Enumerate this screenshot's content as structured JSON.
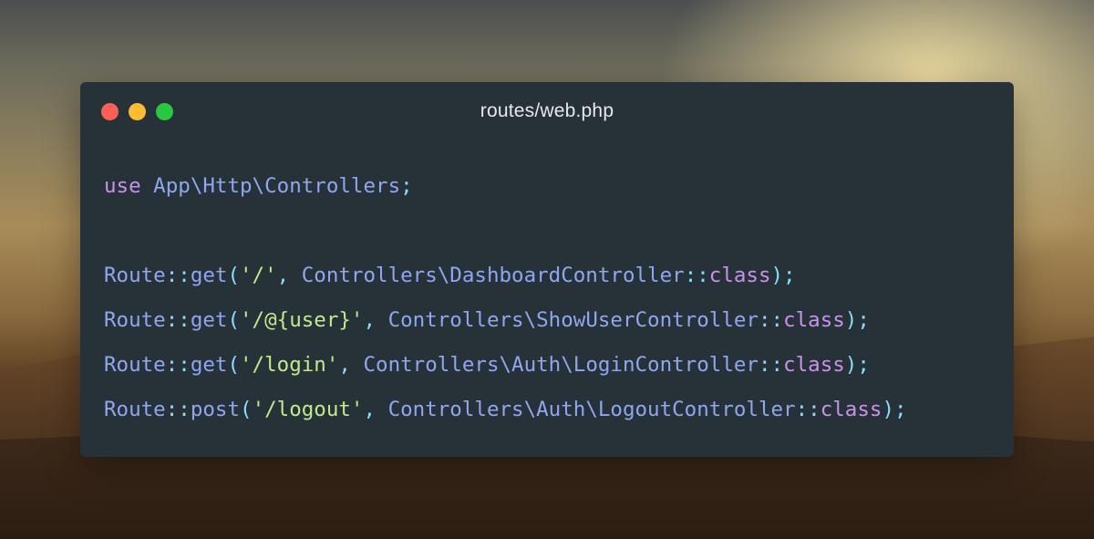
{
  "window": {
    "title": "routes/web.php",
    "controls": [
      {
        "name": "close",
        "color": "#ff5f57"
      },
      {
        "name": "minimize",
        "color": "#febc2e"
      },
      {
        "name": "zoom",
        "color": "#28c840"
      }
    ]
  },
  "colors": {
    "editor_background": "#263238",
    "keyword": "#c792ea",
    "identifier": "#8fa6f0",
    "operator": "#89ddff",
    "string": "#c3e88d"
  },
  "code": {
    "lines": [
      [
        {
          "t": "use",
          "k": "kw"
        },
        {
          "t": " App\\Http\\Controllers",
          "k": "id"
        },
        {
          "t": ";",
          "k": "punc"
        }
      ],
      [],
      [
        {
          "t": "Route",
          "k": "id"
        },
        {
          "t": "::",
          "k": "op"
        },
        {
          "t": "get",
          "k": "id"
        },
        {
          "t": "(",
          "k": "punc"
        },
        {
          "t": "'/'",
          "k": "str"
        },
        {
          "t": ", ",
          "k": "punc"
        },
        {
          "t": "Controllers\\DashboardController",
          "k": "id"
        },
        {
          "t": "::",
          "k": "op"
        },
        {
          "t": "class",
          "k": "kw"
        },
        {
          "t": ");",
          "k": "punc"
        }
      ],
      [
        {
          "t": "Route",
          "k": "id"
        },
        {
          "t": "::",
          "k": "op"
        },
        {
          "t": "get",
          "k": "id"
        },
        {
          "t": "(",
          "k": "punc"
        },
        {
          "t": "'/@{user}'",
          "k": "str"
        },
        {
          "t": ", ",
          "k": "punc"
        },
        {
          "t": "Controllers\\ShowUserController",
          "k": "id"
        },
        {
          "t": "::",
          "k": "op"
        },
        {
          "t": "class",
          "k": "kw"
        },
        {
          "t": ");",
          "k": "punc"
        }
      ],
      [
        {
          "t": "Route",
          "k": "id"
        },
        {
          "t": "::",
          "k": "op"
        },
        {
          "t": "get",
          "k": "id"
        },
        {
          "t": "(",
          "k": "punc"
        },
        {
          "t": "'/login'",
          "k": "str"
        },
        {
          "t": ", ",
          "k": "punc"
        },
        {
          "t": "Controllers\\Auth\\LoginController",
          "k": "id"
        },
        {
          "t": "::",
          "k": "op"
        },
        {
          "t": "class",
          "k": "kw"
        },
        {
          "t": ");",
          "k": "punc"
        }
      ],
      [
        {
          "t": "Route",
          "k": "id"
        },
        {
          "t": "::",
          "k": "op"
        },
        {
          "t": "post",
          "k": "id"
        },
        {
          "t": "(",
          "k": "punc"
        },
        {
          "t": "'/logout'",
          "k": "str"
        },
        {
          "t": ", ",
          "k": "punc"
        },
        {
          "t": "Controllers\\Auth\\LogoutController",
          "k": "id"
        },
        {
          "t": "::",
          "k": "op"
        },
        {
          "t": "class",
          "k": "kw"
        },
        {
          "t": ");",
          "k": "punc"
        }
      ]
    ]
  }
}
